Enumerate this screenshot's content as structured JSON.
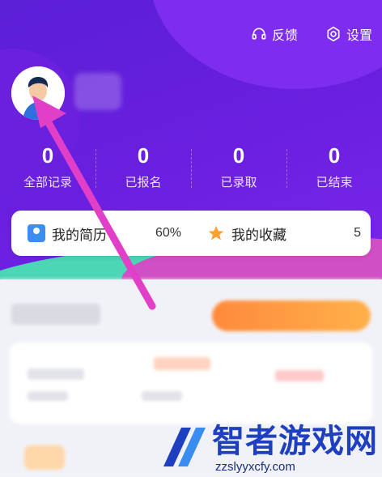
{
  "topbar": {
    "feedback_label": "反馈",
    "settings_label": "设置"
  },
  "stats": [
    {
      "value": "0",
      "label": "全部记录"
    },
    {
      "value": "0",
      "label": "已报名"
    },
    {
      "value": "0",
      "label": "已录取"
    },
    {
      "value": "0",
      "label": "已结束"
    }
  ],
  "cards": {
    "resume": {
      "label": "我的简历",
      "value": "60%"
    },
    "favorites": {
      "label": "我的收藏",
      "value": "5"
    }
  },
  "watermark": {
    "title": "智者游戏网",
    "url": "zzslyyxcfy.com"
  },
  "colors": {
    "header_purple": "#6b1fe0",
    "arrow_pink": "#e23fc8",
    "accent_orange": "#ff8a3c",
    "resume_icon_blue": "#3b8df0",
    "watermark_blue": "#1e3fbf"
  }
}
